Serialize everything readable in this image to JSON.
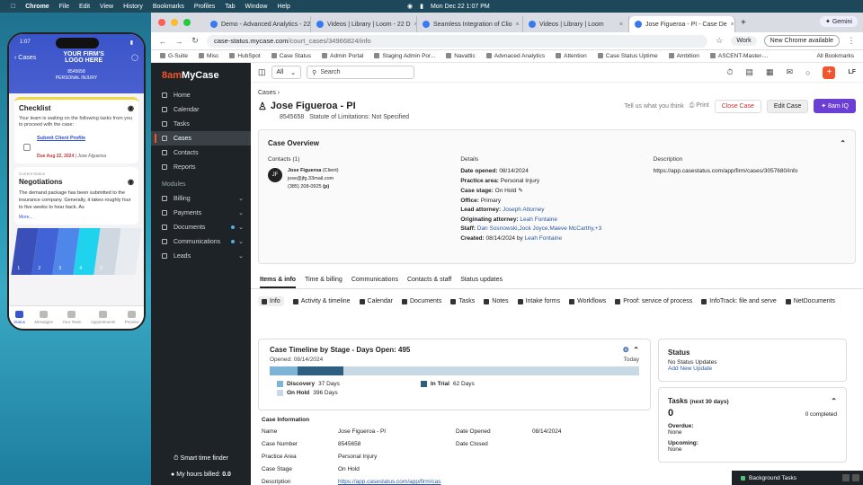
{
  "menubar": {
    "app": "Chrome",
    "items": [
      "File",
      "Edit",
      "View",
      "History",
      "Bookmarks",
      "Profiles",
      "Tab",
      "Window",
      "Help"
    ],
    "clock": "Mon Dec 22  1:07 PM"
  },
  "phone": {
    "time": "1:07",
    "back": "Cases",
    "logo_line1": "YOUR FIRM'S",
    "logo_line2": "LOGO HERE",
    "case_no": "8545658",
    "case_type": "PERSONAL INJURY",
    "checklist": {
      "title": "Checklist",
      "text": "Your team is waiting on the following tasks from you to proceed with the case:",
      "link": "Submit Client Profile",
      "due": "Due Aug 22, 2024",
      "who": "Jose Figueroa"
    },
    "negotiations": {
      "tag": "Current Status",
      "title": "Negotiations",
      "text": "The demand package has been submitted to the insurance company. Generally, it takes roughly four to five weeks to hear back. As",
      "more": "More..."
    },
    "stages": [
      "1",
      "2",
      "3",
      "4",
      "5",
      ""
    ],
    "stage_colors": [
      "#3a4fb8",
      "#4263d6",
      "#4f86ea",
      "#1fd3ef",
      "#cfd8e0",
      "#e8ecf0"
    ],
    "tabs": [
      "Status",
      "Messages",
      "Your Team",
      "Appointments",
      "Preview"
    ]
  },
  "browser": {
    "tabs": [
      {
        "title": "Demo - Advanced Analytics - 22",
        "active": false
      },
      {
        "title": "Videos | Library | Loom - 22 D",
        "active": false
      },
      {
        "title": "Seamless Integration of Clio",
        "active": false
      },
      {
        "title": "Videos | Library | Loom",
        "active": false
      },
      {
        "title": "Jose Figueroa - PI - Case De",
        "active": true
      }
    ],
    "gemini": "Gemini",
    "url_host": "case-status.mycase.com",
    "url_path": "/court_cases/34966824/info",
    "work": "Work",
    "new_chrome": "New Chrome available",
    "bookmarks": [
      "G-Suite",
      "Misc",
      "HubSpot",
      "Case Status",
      "Admin Portal",
      "Staging Admin Por...",
      "Navattic",
      "Advnaced Analytics",
      "Attention",
      "Case Status Uptime",
      "Ambition",
      "ASCENT-Master-..."
    ],
    "all_bookmarks": "All Bookmarks"
  },
  "sidebar": {
    "logo_a": "8am",
    "logo_b": "MyCase",
    "items": [
      {
        "label": "Home"
      },
      {
        "label": "Calendar"
      },
      {
        "label": "Tasks"
      },
      {
        "label": "Cases"
      },
      {
        "label": "Contacts"
      },
      {
        "label": "Reports"
      }
    ],
    "modules_label": "Modules",
    "modules": [
      {
        "label": "Billing"
      },
      {
        "label": "Payments"
      },
      {
        "label": "Documents"
      },
      {
        "label": "Communications"
      },
      {
        "label": "Leads"
      }
    ],
    "smart_time": "Smart time finder",
    "hours": "My hours billed:",
    "hours_value": "0.0"
  },
  "topbar": {
    "select": "All",
    "search_placeholder": "Search",
    "user": "LF"
  },
  "case": {
    "crumb": "Cases",
    "title": "Jose Figueroa - PI",
    "number": "8545658",
    "sol_label": "Statute of Limitations:",
    "sol_value": "Not Specified",
    "tell_us": "Tell us what you think",
    "print": "Print",
    "close": "Close Case",
    "edit": "Edit Case",
    "iq": "8am IQ"
  },
  "overview": {
    "title": "Case Overview",
    "contacts_hd": "Contacts (1)",
    "contact_name": "Jose Figueroa",
    "contact_role": "(Client)",
    "contact_email": "jose@jfg.33mail.com",
    "contact_phone": "(385) 208-0925",
    "contact_phone_tag": "(p)",
    "details_hd": "Details",
    "date_opened": "08/14/2024",
    "practice_area": "Personal Injury",
    "case_stage": "On Hold",
    "office": "Primary",
    "lead_attorney": "Joseph Attorney",
    "originating_attorney": "Leah Fontaine",
    "staff": [
      "Dan Sosnowski,",
      "Jock Joyce,",
      "Maeve McCarthy,",
      "+3"
    ],
    "created": "08/14/2024",
    "created_by": "Leah Fontaine",
    "description_hd": "Description",
    "description": "https://app.casestatus.com/app/firm/cases/3057680/info",
    "labels": {
      "date_opened": "Date opened:",
      "practice_area": "Practice area:",
      "case_stage": "Case stage:",
      "office": "Office:",
      "lead_attorney": "Lead attorney:",
      "originating_attorney": "Originating attorney:",
      "staff": "Staff:",
      "created": "Created:",
      "by": "by"
    }
  },
  "tabs": [
    "Items & info",
    "Time & billing",
    "Communications",
    "Contacts & staff",
    "Status updates"
  ],
  "subnav": [
    "Info",
    "Activity & timeline",
    "Calendar",
    "Documents",
    "Tasks",
    "Notes",
    "Intake forms",
    "Workflows",
    "Proof: service of process",
    "InfoTrack: file and serve",
    "NetDocuments"
  ],
  "timeline": {
    "title": "Case Timeline by Stage - Days Open:",
    "days": "495",
    "opened": "Opened: 08/14/2024",
    "today": "Today",
    "segments": [
      {
        "name": "Discovery",
        "days": 37,
        "color": "#7fb3d6"
      },
      {
        "name": "In Trial",
        "days": 62,
        "color": "#2f5f80"
      },
      {
        "name": "On Hold",
        "days": 396,
        "color": "#c6d9e5"
      }
    ],
    "days_suffix": "Days"
  },
  "info": {
    "title": "Case Information",
    "rows": [
      {
        "k1": "Name",
        "v1": "Jose Figueroa - PI",
        "k2": "Date Opened",
        "v2": "08/14/2024"
      },
      {
        "k1": "Case Number",
        "v1": "8545658",
        "k2": "Date Closed",
        "v2": ""
      },
      {
        "k1": "Practice Area",
        "v1": "Personal Injury",
        "k2": "",
        "v2": ""
      },
      {
        "k1": "Case Stage",
        "v1": "On Hold",
        "k2": "",
        "v2": ""
      },
      {
        "k1": "Description",
        "v1": "https://app.casestatus.com/app/firm/cas",
        "k2": "",
        "v2": ""
      }
    ]
  },
  "status_panel": {
    "title": "Status",
    "text": "No Status Updates",
    "link": "Add New Update"
  },
  "tasks_panel": {
    "title": "Tasks",
    "suffix": "(next 30 days)",
    "count": "0",
    "completed": "0 completed",
    "overdue": "Overdue:",
    "overdue_v": "None",
    "upcoming": "Upcoming:",
    "upcoming_v": "None"
  },
  "bg_tasks": "Background Tasks"
}
